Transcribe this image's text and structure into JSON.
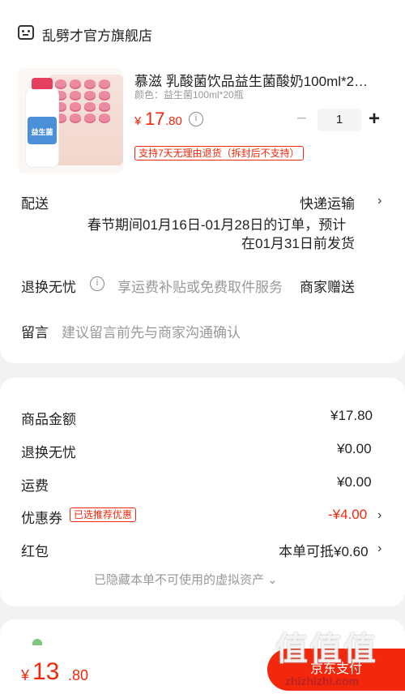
{
  "store": {
    "name": "乱劈才官方旗舰店"
  },
  "product": {
    "title": "慕滋 乳酸菌饮品益生菌酸奶100ml*2…",
    "spec": "颜色：益生菌100ml*20瓶",
    "image_label": "益生菌",
    "price_symbol": "¥",
    "price_int": "17",
    "price_dec": ".80",
    "quantity": "1",
    "minus": "−",
    "plus": "+",
    "return_policy": "支持7天无理由退货（拆封后不支持）"
  },
  "delivery": {
    "label": "配送",
    "method": "快递运输",
    "note_line1": "春节期间01月16日-01月28日的订单，预计",
    "note_line2": "在01月31日前发货"
  },
  "worry_free": {
    "label": "退换无忧",
    "desc": "享运费补贴或免费取件服务",
    "value": "商家赠送"
  },
  "message": {
    "label": "留言",
    "placeholder": "建议留言前先与商家沟通确认"
  },
  "summary": {
    "goods_label": "商品金额",
    "goods_value": "¥17.80",
    "worry_label": "退换无忧",
    "worry_value": "¥0.00",
    "freight_label": "运费",
    "freight_value": "¥0.00",
    "coupon_label": "优惠券",
    "coupon_tag": "已选推荐优惠",
    "coupon_value": "-¥4.00",
    "redpacket_label": "红包",
    "redpacket_value": "本单可抵¥0.60",
    "hidden_assets": "已隐藏本单不可使用的虚拟资产 ⌄"
  },
  "footer": {
    "total_symbol": "¥",
    "total_int": "13",
    "total_dec": ".80",
    "pay_label": "京东支付",
    "watermark": "值值值",
    "watermark_url": "zhizhizhi.com"
  },
  "icons": {
    "store": "store-icon",
    "info": "info-icon",
    "chevron": "chevron-right-icon"
  },
  "colors": {
    "accent": "#f2270c",
    "background": "#f2f2f2"
  }
}
